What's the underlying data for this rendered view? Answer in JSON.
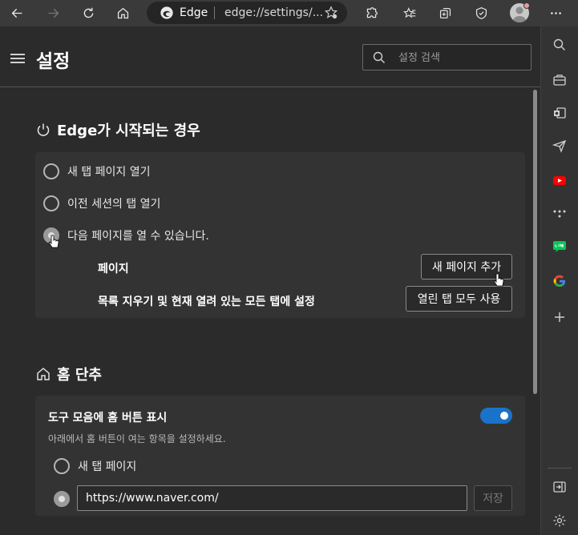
{
  "browser": {
    "site_name": "Edge",
    "url": "edge://settings/...",
    "icons": [
      "back-icon",
      "forward-icon",
      "refresh-icon",
      "home-icon",
      "favorite-icon",
      "extensions-icon",
      "favorites-icon",
      "collections-icon",
      "browser-essentials-icon",
      "profile-avatar",
      "more-icon"
    ]
  },
  "sidebar": {
    "icons": [
      "search-icon",
      "tools-icon",
      "outlook-icon",
      "send-icon",
      "youtube-icon",
      "games-icon",
      "line-icon",
      "google-icon",
      "add-icon",
      "exit-icon",
      "settings-icon"
    ]
  },
  "settings": {
    "title": "설정",
    "search_placeholder": "설정 검색"
  },
  "startup": {
    "title": "Edge가 시작되는 경우",
    "options": [
      "새 탭 페이지 열기",
      "이전 세션의 탭 열기",
      "다음 페이지를 열 수 있습니다."
    ],
    "selected": 2,
    "pages_label": "페이지",
    "add_page_button": "새 페이지 추가",
    "clear_label": "목록 지우기 및 현재 열려 있는 모든 탭에 설정",
    "use_open_tabs_button": "열린 탭 모두 사용"
  },
  "home": {
    "title": "홈 단추",
    "toggle_label": "도구 모음에 홈 버튼 표시",
    "toggle_on": true,
    "subtext": "아래에서 홈 버튼이 여는 항목을 설정하세요.",
    "option_newtab": "새 탭 페이지",
    "url_value": "https://www.naver.com/",
    "save_button": "저장"
  },
  "colors": {
    "toggle_on": "#1a73c8",
    "background": "#2b2b2b",
    "card": "#333333"
  }
}
